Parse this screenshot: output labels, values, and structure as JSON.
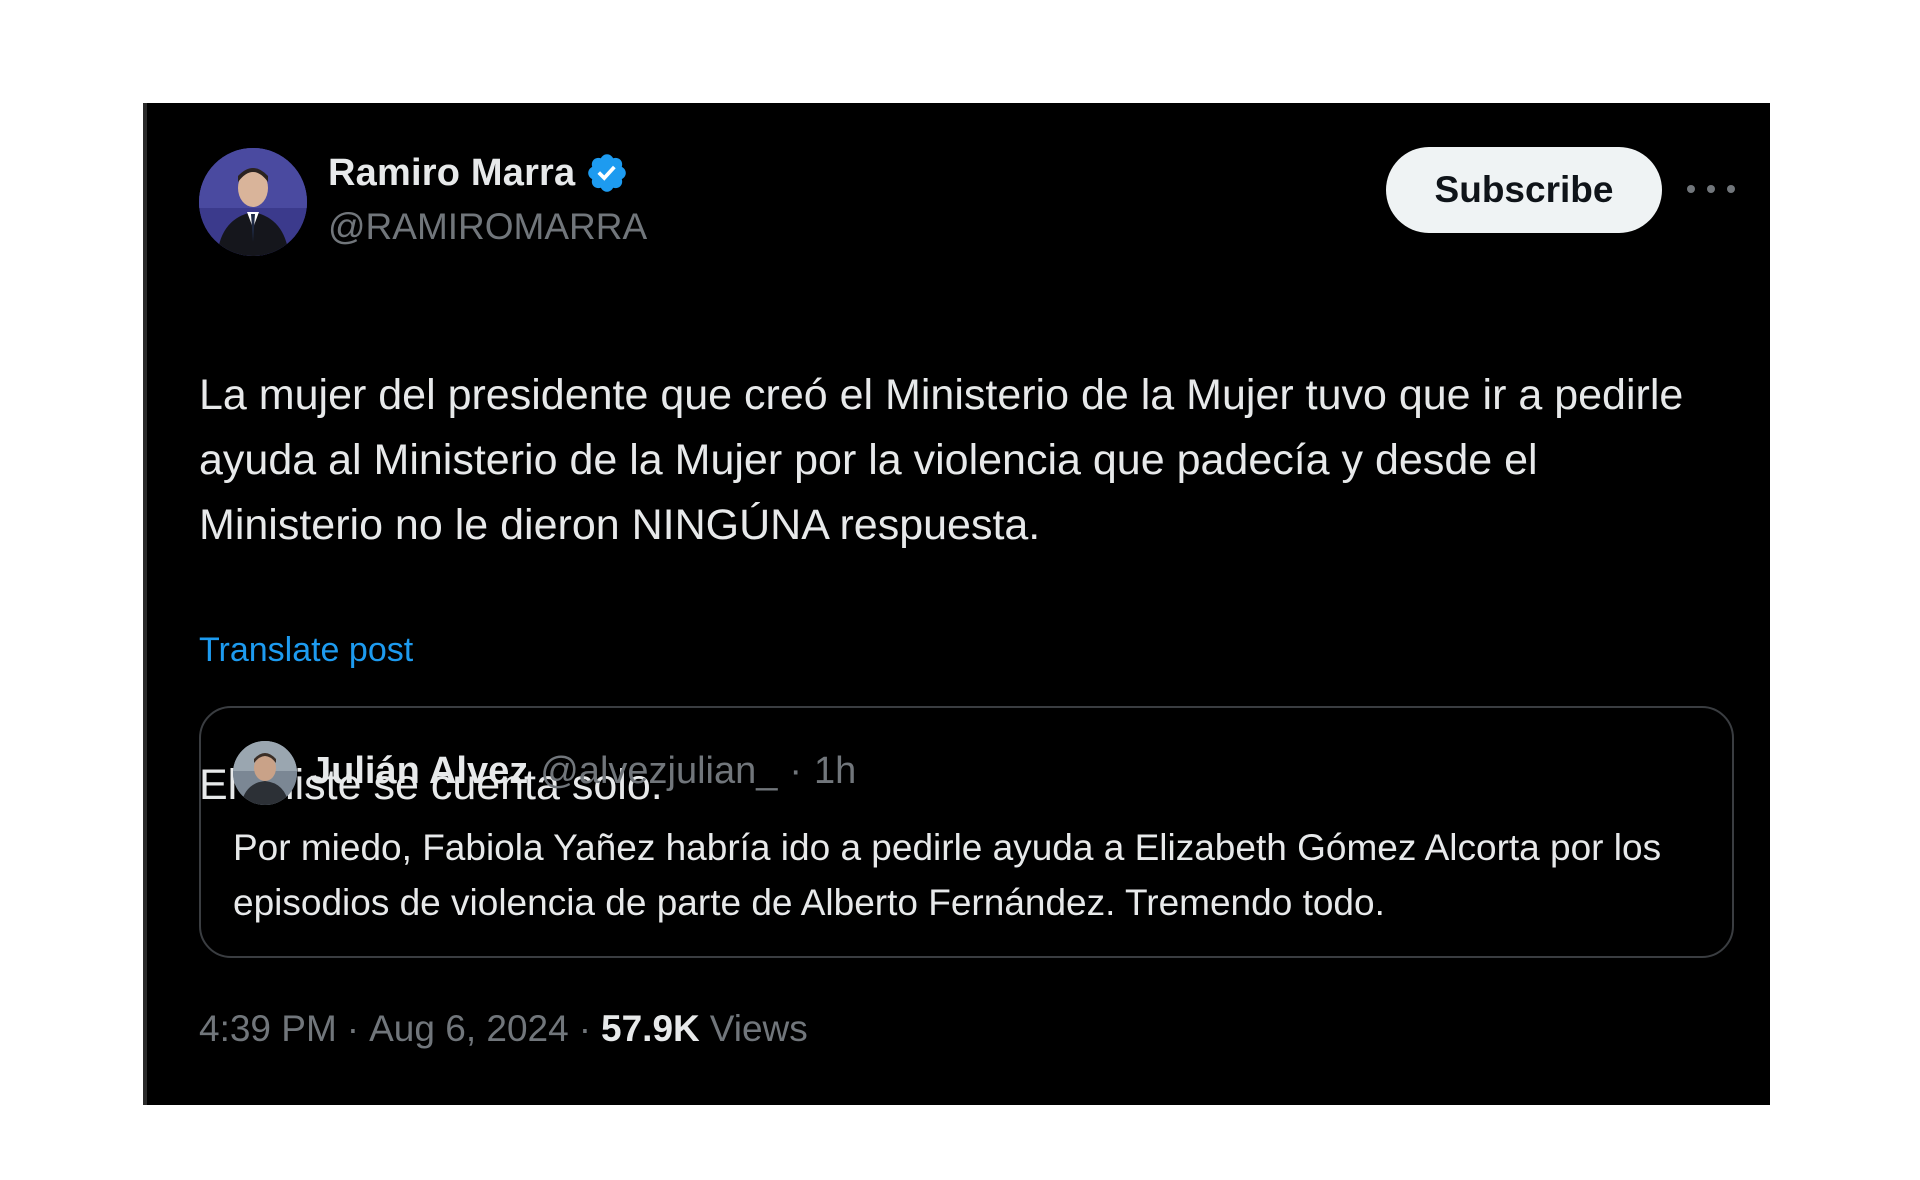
{
  "author": {
    "name": "Ramiro Marra",
    "handle": "@RAMIROMARRA",
    "verified": true,
    "verified_color": "#1d9bf0"
  },
  "actions": {
    "subscribe_label": "Subscribe",
    "more_icon": "more-horizontal-icon"
  },
  "tweet": {
    "paragraph1": "La mujer del presidente que creó el Ministerio de la Mujer tuvo que ir a pedirle ayuda al Ministerio de la Mujer por la violencia que padecía y desde el Ministerio no le dieron NINGÚNA respuesta.",
    "paragraph2": "El chiste se cuenta solo.",
    "translate_label": "Translate post"
  },
  "quote": {
    "name": "Julián Alvez",
    "handle": "@alvezjulian_",
    "separator": "·",
    "time": "1h",
    "text": "Por miedo, Fabiola Yañez habría ido a pedirle ayuda a Elizabeth Gómez Alcorta por los episodios de violencia de parte de Alberto Fernández. Tremendo todo."
  },
  "meta": {
    "time": "4:39 PM",
    "sep1": "·",
    "date": "Aug 6, 2024",
    "sep2": "·",
    "views_count": "57.9K",
    "views_label": "Views"
  },
  "colors": {
    "background": "#000000",
    "text": "#e7e9ea",
    "secondary": "#71767b",
    "link": "#1d9bf0",
    "border": "#3a3d41"
  }
}
